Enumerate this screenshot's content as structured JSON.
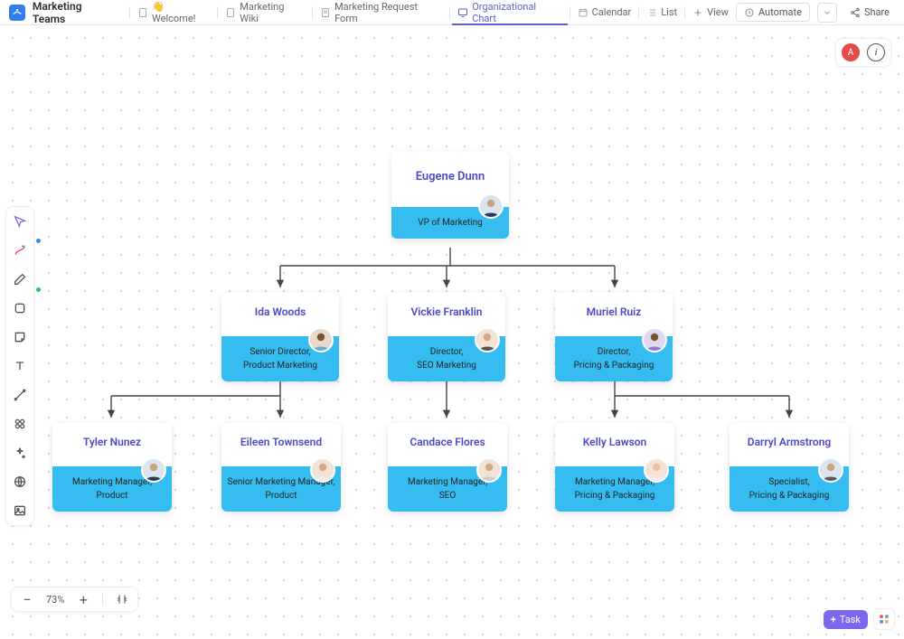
{
  "header": {
    "page_title": "Marketing Teams",
    "tabs": [
      {
        "label": "👋 Welcome!"
      },
      {
        "label": "Marketing Wiki"
      },
      {
        "label": "Marketing Request Form"
      },
      {
        "label": "Organizational Chart"
      },
      {
        "label": "Calendar"
      },
      {
        "label": "List"
      },
      {
        "label": "View"
      }
    ],
    "active_tab": 3,
    "automate_label": "Automate",
    "share_label": "Share",
    "user_initial": "A"
  },
  "zoom": {
    "percent_label": "73%"
  },
  "bottom": {
    "task_label": "Task"
  },
  "chart_data": {
    "type": "org-chart",
    "nodes": [
      {
        "id": "eugene",
        "name": "Eugene Dunn",
        "title_line1": "VP of Marketing",
        "title_line2": "",
        "avatar_bg": "#d9e6f2"
      },
      {
        "id": "ida",
        "name": "Ida Woods",
        "title_line1": "Senior Director,",
        "title_line2": "Product Marketing",
        "avatar_bg": "#e7d9cc"
      },
      {
        "id": "vickie",
        "name": "Vickie Franklin",
        "title_line1": "Director,",
        "title_line2": "SEO Marketing",
        "avatar_bg": "#f2e3d9"
      },
      {
        "id": "muriel",
        "name": "Muriel Ruiz",
        "title_line1": "Director,",
        "title_line2": "Pricing & Packaging",
        "avatar_bg": "#e0d9f2"
      },
      {
        "id": "tyler",
        "name": "Tyler Nunez",
        "title_line1": "Marketing Manager,",
        "title_line2": "Product",
        "avatar_bg": "#d9e6f2"
      },
      {
        "id": "eileen",
        "name": "Eileen Townsend",
        "title_line1": "Senior Marketing Manager,",
        "title_line2": "Product",
        "avatar_bg": "#f2e3d9"
      },
      {
        "id": "candace",
        "name": "Candace Flores",
        "title_line1": "Marketing Manager,",
        "title_line2": "SEO",
        "avatar_bg": "#f2e3d9"
      },
      {
        "id": "kelly",
        "name": "Kelly Lawson",
        "title_line1": "Marketing Manager,",
        "title_line2": "Pricing & Packaging",
        "avatar_bg": "#f2e3d9"
      },
      {
        "id": "darryl",
        "name": "Darryl Armstrong",
        "title_line1": "Specialist,",
        "title_line2": "Pricing & Packaging",
        "avatar_bg": "#d9e6f2"
      }
    ],
    "edges": [
      [
        "eugene",
        "ida"
      ],
      [
        "eugene",
        "vickie"
      ],
      [
        "eugene",
        "muriel"
      ],
      [
        "ida",
        "tyler"
      ],
      [
        "ida",
        "eileen"
      ],
      [
        "vickie",
        "candace"
      ],
      [
        "muriel",
        "kelly"
      ],
      [
        "muriel",
        "darryl"
      ]
    ]
  }
}
